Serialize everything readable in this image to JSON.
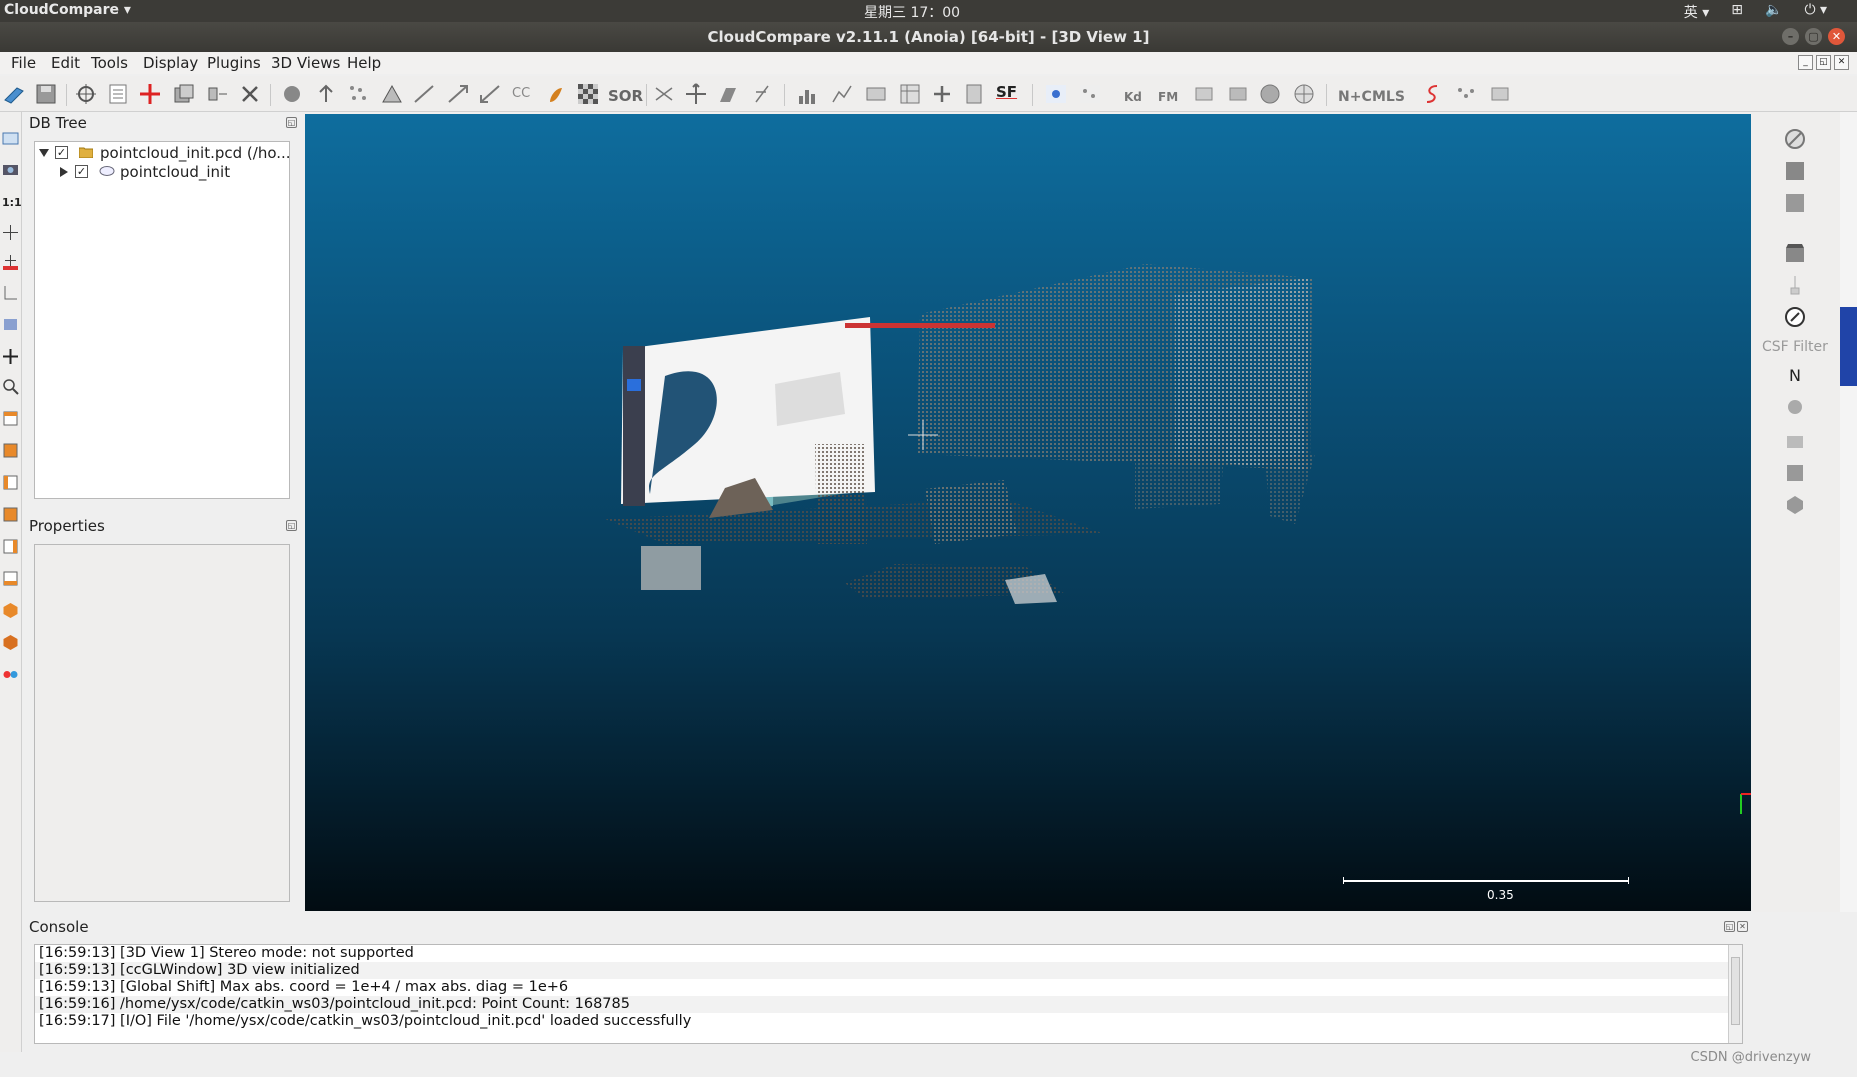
{
  "system_bar": {
    "app_name": "CloudCompare",
    "clock": "星期三 17：00",
    "input_method": "英"
  },
  "window": {
    "title": "CloudCompare v2.11.1 (Anoia) [64-bit] - [3D View 1]"
  },
  "menu": {
    "items": [
      "File",
      "Edit",
      "Tools",
      "Display",
      "Plugins",
      "3D Views",
      "Help"
    ]
  },
  "toolbar": {
    "text_icons": {
      "cc": "CC",
      "sor": "SOR",
      "sf": "SF",
      "kd": "Kd",
      "fm": "FM",
      "nc": "N+C",
      "mls": "MLS"
    }
  },
  "left_toolbar": {
    "one_to_one": "1:1"
  },
  "db_tree": {
    "title": "DB Tree",
    "items": [
      {
        "label": "pointcloud_init.pcd (/ho...",
        "checked": true,
        "expanded": true,
        "icon": "folder-icon"
      },
      {
        "label": "pointcloud_init",
        "checked": true,
        "expanded": false,
        "icon": "cloud-icon"
      }
    ]
  },
  "properties": {
    "title": "Properties"
  },
  "view3d": {
    "scale_label": "0.35"
  },
  "right_toolbar": {
    "csf_label": "CSF Filter",
    "n_label": "N"
  },
  "console": {
    "title": "Console",
    "lines": [
      "[16:59:13] [3D View 1] Stereo mode: not supported",
      "[16:59:13] [ccGLWindow] 3D view initialized",
      "[16:59:13] [Global Shift] Max abs. coord = 1e+4 / max abs. diag = 1e+6",
      "[16:59:16] /home/ysx/code/catkin_ws03/pointcloud_init.pcd: Point Count: 168785",
      "[16:59:17] [I/O] File '/home/ysx/code/catkin_ws03/pointcloud_init.pcd' loaded successfully"
    ]
  },
  "watermark": "CSDN @drivenzyw"
}
